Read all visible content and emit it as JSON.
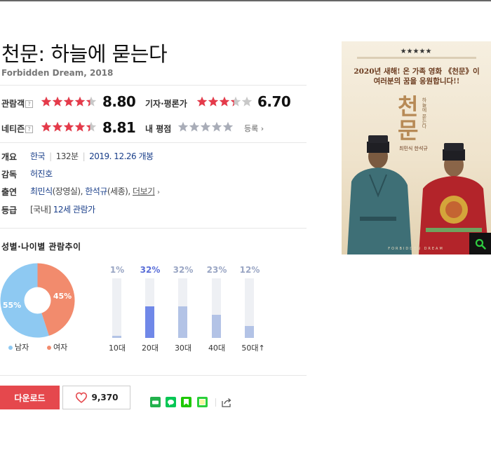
{
  "movie": {
    "title": "천문: 하늘에 묻는다",
    "subtitle": "Forbidden Dream, 2018"
  },
  "ratings": {
    "audience": {
      "label": "관람객",
      "help": "?",
      "score": "8.80",
      "stars": 4.4
    },
    "critics": {
      "label": "기자·평론가",
      "score": "6.70",
      "stars": 3.35
    },
    "netizen": {
      "label": "네티즌",
      "help": "?",
      "score": "8.81",
      "stars": 4.4
    },
    "mine": {
      "label": "내 평점",
      "stars": 0,
      "register_label": "등록",
      "register_arrow": "›"
    }
  },
  "info": {
    "overview_label": "개요",
    "country": "한국",
    "runtime": "132분",
    "release": "2019. 12.26 개봉",
    "director_label": "감독",
    "director": "허진호",
    "cast_label": "출연",
    "cast_1": "최민식",
    "cast_1_role": "(장영실)",
    "cast_sep": ",",
    "cast_2": "한석규",
    "cast_2_role": "(세종)",
    "more_label": "더보기",
    "more_arrow": "›",
    "rating_label": "등급",
    "rating_prefix": "[국내]",
    "rating_value": "12세 관람가"
  },
  "trend": {
    "title": "성별·나이별 관람추이",
    "gender": {
      "male": {
        "label": "남자",
        "pct_label": "55%",
        "value": 55,
        "color": "#8ec9f2"
      },
      "female": {
        "label": "여자",
        "pct_label": "45%",
        "value": 45,
        "color": "#f28b6d"
      }
    },
    "ages": [
      {
        "label": "10대",
        "pct_label": "1%",
        "value": 1,
        "highlight": false
      },
      {
        "label": "20대",
        "pct_label": "32%",
        "value": 32,
        "highlight": true
      },
      {
        "label": "30대",
        "pct_label": "32%",
        "value": 32,
        "highlight": false
      },
      {
        "label": "40대",
        "pct_label": "23%",
        "value": 23,
        "highlight": false
      },
      {
        "label": "50대",
        "pct_label": "12%",
        "value": 12,
        "highlight": false,
        "suffix": "↑"
      }
    ],
    "colors": {
      "highlight_bar": "#7088e8",
      "normal_bar": "#b3c3e6",
      "highlight_text": "#5a6ed8",
      "normal_text": "#9aa6c4"
    }
  },
  "actions": {
    "download_label": "다운로드",
    "like_count": "9,370",
    "share_icons": [
      "band-icon",
      "line-icon",
      "bookmark-icon",
      "memo-icon",
      "share-icon"
    ]
  },
  "poster": {
    "rating_stars": "★★★★★",
    "tagline_1": "2020년 새해! 온 가족 영화 《천문》이",
    "tagline_2": "여러분의 꿈을 응원합니다!!",
    "title_1": "천",
    "title_2": "문",
    "subtitle": "하늘에 묻는다",
    "actors": "최민식 한석규",
    "search_icon": "search-icon"
  },
  "colors": {
    "accent_red": "#e5484d",
    "star_red": "#e53a4a",
    "star_gray": "#c8c8c8"
  }
}
